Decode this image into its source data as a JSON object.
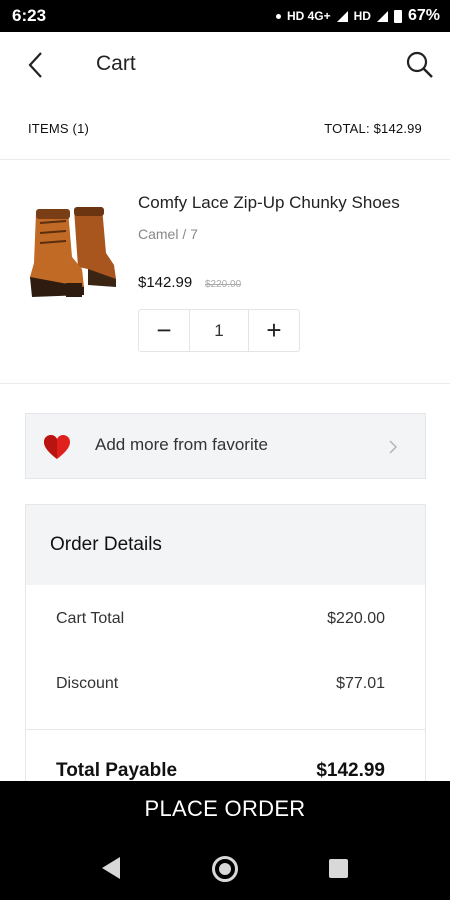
{
  "status_bar": {
    "time": "6:23",
    "network": "HD 4G+",
    "network2": "HD",
    "battery": "67%"
  },
  "app_bar": {
    "title": "Cart",
    "back_icon": "back-arrow-icon",
    "search_icon": "search-icon"
  },
  "summary": {
    "items_label": "ITEMS (1)",
    "total_label": "TOTAL: $142.99"
  },
  "cart_item": {
    "name": "Comfy Lace Zip-Up Chunky Shoes",
    "variant": "Camel / 7",
    "price": "$142.99",
    "original_price": "$220.00",
    "quantity": "1",
    "decrement_label": "−",
    "increment_label": "+"
  },
  "favorite": {
    "label": "Add more from favorite",
    "icon": "heart-icon",
    "heart_color": "#e0201c"
  },
  "order_details": {
    "title": "Order Details",
    "lines": [
      {
        "label": "Cart Total",
        "value": "$220.00"
      },
      {
        "label": "Discount",
        "value": "$77.01"
      }
    ],
    "total": {
      "label": "Total Payable",
      "value": "$142.99"
    }
  },
  "place_order": {
    "label": "PLACE ORDER"
  },
  "nav_bar": {
    "icons": [
      "nav-back-icon",
      "nav-home-icon",
      "nav-recents-icon"
    ]
  }
}
